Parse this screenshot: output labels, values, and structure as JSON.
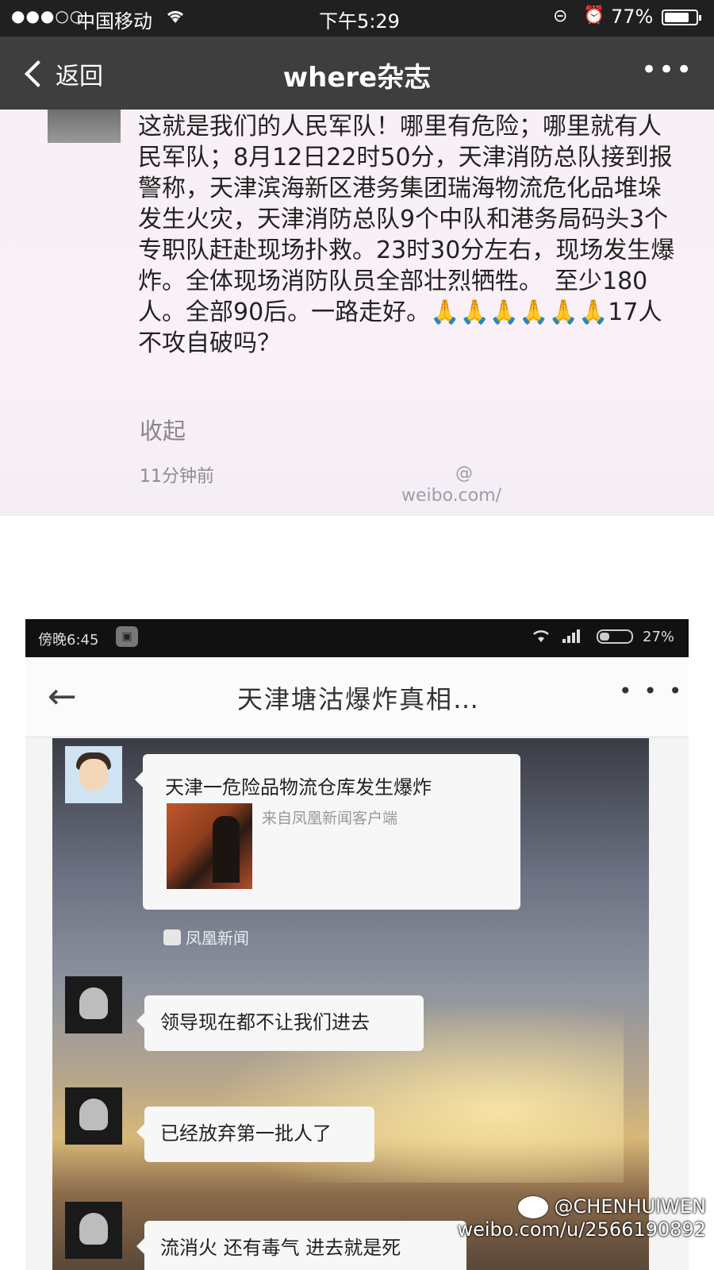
{
  "status_bar": {
    "signal": "●●●○○",
    "carrier": "中国移动",
    "time": "下午5:29",
    "battery": "77%",
    "icons": [
      "wifi-icon",
      "orientation-lock-icon",
      "alarm-icon",
      "battery-icon"
    ]
  },
  "nav": {
    "back_label": "返回",
    "title": "where杂志",
    "more": "•••"
  },
  "post": {
    "body": "这就是我们的人民军队！哪里有危险；哪里就有人民军队；8月12日22时50分，天津消防总队接到报警称，天津滨海新区港务集团瑞海物流危化品堆垛发生火灾，天津消防总队9个中队和港务局码头3个专职队赶赴现场扑救。23时30分左右，现场发生爆炸。全体现场消防队员全部壮烈牺牲。　至少180人。全部90后。一路走好。🙏🙏🙏🙏🙏🙏17人不攻自破吗？",
    "collapse": "收起",
    "time": "11分钟前",
    "watermark_line1": "@",
    "watermark_line2": "weibo.com/"
  },
  "embedded_screenshot": {
    "status": {
      "time": "傍晚6:45",
      "battery": "27%"
    },
    "header_title": "天津塘沽爆炸真相…",
    "more": "• • •",
    "chat": {
      "news_title": "天津一危险品物流仓库发生爆炸",
      "news_source": "来自凤凰新闻客户端",
      "app_tag": "凤凰新闻",
      "messages": [
        {
          "text": "领导现在都不让我们进去"
        },
        {
          "text": "已经放弃第一批人了"
        },
        {
          "text": "流消火 还有毒气 进去就是死"
        }
      ]
    }
  },
  "watermark": {
    "handle": "@CHENHUIWEN",
    "url": "weibo.com/u/2566190892"
  }
}
